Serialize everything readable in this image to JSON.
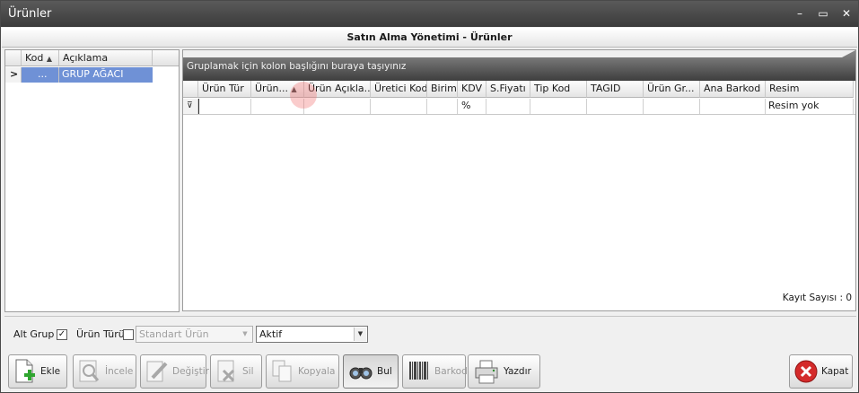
{
  "window": {
    "title": "Ürünler",
    "controls": [
      "–",
      "▭",
      "✕"
    ]
  },
  "header": {
    "title": "Satın Alma Yönetimi - Ürünler"
  },
  "left_grid": {
    "columns": [
      "Kod",
      "Açıklama"
    ],
    "sort_indicator": "▲",
    "rows": [
      {
        "indicator": ">",
        "kod": "...",
        "aciklama": "GRUP AĞACI"
      }
    ]
  },
  "right_grid": {
    "group_hint": "Gruplamak için kolon başlığını buraya taşıyınız",
    "columns": [
      "Ürün Tür",
      "Ürün...",
      "Ürün Açıkla...",
      "Üretici Kod",
      "Birim",
      "KDV",
      "S.Fiyatı",
      "Tip Kod",
      "TAGID",
      "Ürün Gr...",
      "Ana Barkod",
      "Resim"
    ],
    "sort_indicator": "▲",
    "filter_row": {
      "kdv": "%",
      "resim": "Resim yok"
    },
    "record_count": "Kayıt Sayısı : 0"
  },
  "filters": {
    "alt_grup_label": "Alt Grup",
    "alt_grup_checked": "✓",
    "urun_turu_label": "Ürün Türü",
    "urun_turu_value": "Standart Ürün",
    "status_value": "Aktif"
  },
  "toolbar": {
    "ekle": "Ekle",
    "incele": "İncele",
    "degistir": "Değiştir",
    "sil": "Sil",
    "kopyala": "Kopyala",
    "bul": "Bul",
    "barkod": "Barkod",
    "yazdir": "Yazdır",
    "kapat": "Kapat"
  },
  "colors": {
    "accent": "#3d3d3d",
    "selection": "#6f91d6",
    "close_red": "#d42a2a"
  }
}
